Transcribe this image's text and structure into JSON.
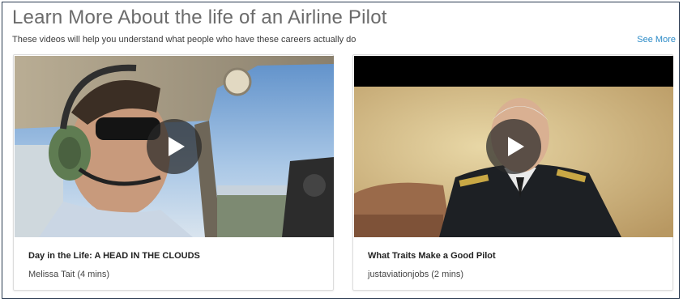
{
  "section": {
    "title": "Learn More About the life of an Airline Pilot",
    "subtitle": "These videos will help you understand what people who have these careers actually do",
    "see_more_label": "See More"
  },
  "videos": [
    {
      "title": "Day in the Life: A HEAD IN THE CLOUDS",
      "meta": "Melissa Tait (4 mins)",
      "icon": "play-icon"
    },
    {
      "title": "What Traits Make a Good Pilot",
      "meta": "justaviationjobs (2 mins)",
      "icon": "play-icon"
    }
  ],
  "colors": {
    "accent": "#2a8ac7",
    "title": "#6b6b6b",
    "border": "#2a3a50"
  }
}
